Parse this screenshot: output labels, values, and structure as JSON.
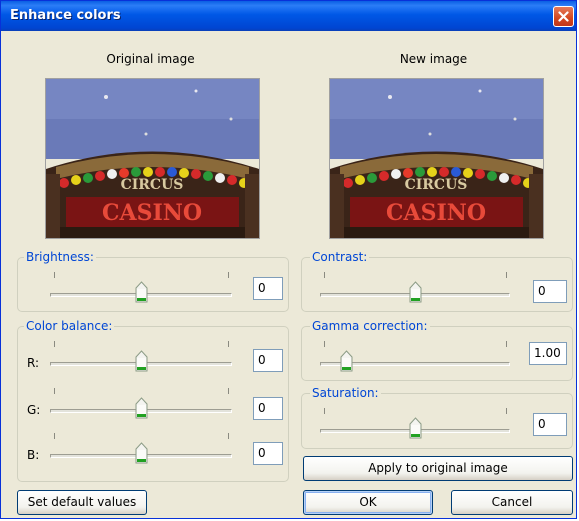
{
  "window": {
    "title": "Enhance colors"
  },
  "images": {
    "original_label": "Original image",
    "new_label": "New image",
    "sign_text_top": "CIRCUS",
    "sign_text_bottom": "CASINO"
  },
  "brightness": {
    "label": "Brightness:",
    "value": "0",
    "level": 0.5
  },
  "color_balance": {
    "label": "Color balance:",
    "channels": [
      {
        "label": "R:",
        "value": "0",
        "level": 0.5
      },
      {
        "label": "G:",
        "value": "0",
        "level": 0.5
      },
      {
        "label": "B:",
        "value": "0",
        "level": 0.5
      }
    ]
  },
  "contrast": {
    "label": "Contrast:",
    "value": "0",
    "level": 0.5
  },
  "gamma": {
    "label": "Gamma correction:",
    "value": "1.00",
    "level": 0.12
  },
  "saturation": {
    "label": "Saturation:",
    "value": "0",
    "level": 0.5
  },
  "buttons": {
    "apply": "Apply to original image",
    "defaults": "Set default values",
    "ok": "OK",
    "cancel": "Cancel"
  },
  "colors": {
    "title_bar": "#0058e6",
    "group_label": "#0046d5",
    "dialog_bg": "#ece9d8"
  }
}
